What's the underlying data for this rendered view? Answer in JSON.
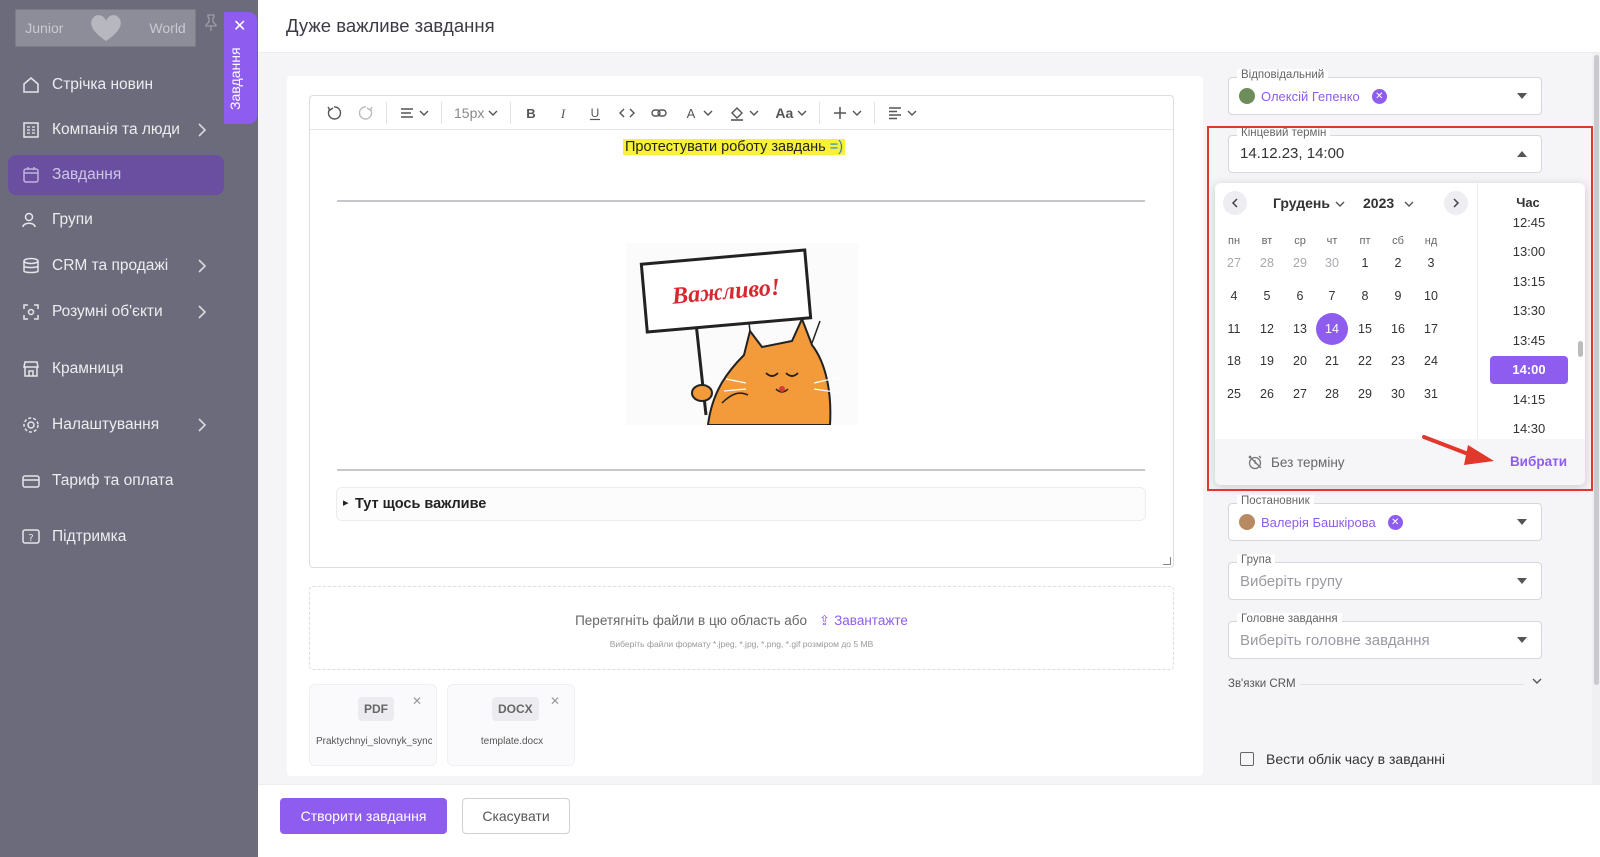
{
  "sidebar": {
    "logo_left": "Junior",
    "logo_right": "World",
    "items": [
      {
        "label": "Стрічка новин",
        "icon": "home-icon",
        "chevron": false
      },
      {
        "label": "Компанія та люди",
        "icon": "building-icon",
        "chevron": true
      },
      {
        "label": "Завдання",
        "icon": "calendar-icon",
        "chevron": false,
        "active": true
      },
      {
        "label": "Групи",
        "icon": "users-icon",
        "chevron": false
      },
      {
        "label": "CRM та продажі",
        "icon": "database-icon",
        "chevron": true
      },
      {
        "label": "Розумні об'єкти",
        "icon": "scan-icon",
        "chevron": true
      },
      {
        "label": "Крамниця",
        "icon": "store-icon",
        "chevron": false
      },
      {
        "label": "Налаштування",
        "icon": "gear-icon",
        "chevron": true
      },
      {
        "label": "Тариф та оплата",
        "icon": "card-icon",
        "chevron": false
      },
      {
        "label": "Підтримка",
        "icon": "help-icon",
        "chevron": false
      }
    ]
  },
  "vertical_tab": {
    "label": "Завдання"
  },
  "header": {
    "title": "Дуже важливе завдання"
  },
  "toolbar": {
    "font_size": "15px",
    "case_label": "Aa"
  },
  "editor": {
    "highlight_text": "Протестувати роботу завдань",
    "highlight_smile": "=)",
    "image_sign_text": "Важливо!",
    "details_summary": "Тут щось важливе"
  },
  "dropzone": {
    "main_text": "Перетягніть файли в цю область або",
    "upload_label": "Завантажте",
    "hint": "Виберіть файли формату *.jpeg, *.jpg, *.png, *.gif розміром до 5 MB"
  },
  "files": [
    {
      "type": "PDF",
      "name": "Praktychnyi_slovnyk_sync"
    },
    {
      "type": "DOCX",
      "name": "template.docx"
    }
  ],
  "footer": {
    "create_label": "Створити завдання",
    "cancel_label": "Скасувати"
  },
  "fields": {
    "responsible": {
      "label": "Відповідальний",
      "value": "Олексій Гепенко"
    },
    "deadline": {
      "label": "Кінцевий термін",
      "value": "14.12.23, 14:00"
    },
    "author": {
      "label": "Постановник",
      "value": "Валерія Башкірова"
    },
    "group": {
      "label": "Група",
      "placeholder": "Виберіть групу"
    },
    "parent": {
      "label": "Головне завдання",
      "placeholder": "Виберіть головне завдання"
    },
    "crm": {
      "label": "Зв'язки CRM"
    },
    "time_tracking": {
      "label": "Вести облік часу в завданні"
    }
  },
  "picker": {
    "month": "Грудень",
    "year": "2023",
    "weekdays": [
      "пн",
      "вт",
      "ср",
      "чт",
      "пт",
      "сб",
      "нд"
    ],
    "weeks": [
      [
        "27",
        "28",
        "29",
        "30",
        "1",
        "2",
        "3"
      ],
      [
        "4",
        "5",
        "6",
        "7",
        "8",
        "9",
        "10"
      ],
      [
        "11",
        "12",
        "13",
        "14",
        "15",
        "16",
        "17"
      ],
      [
        "18",
        "19",
        "20",
        "21",
        "22",
        "23",
        "24"
      ],
      [
        "25",
        "26",
        "27",
        "28",
        "29",
        "30",
        "31"
      ]
    ],
    "selected_day": "14",
    "time_header": "Час",
    "times": [
      "12:45",
      "13:00",
      "13:15",
      "13:30",
      "13:45",
      "14:00",
      "14:15",
      "14:30"
    ],
    "selected_time": "14:00",
    "no_deadline_label": "Без терміну",
    "choose_label": "Вибрати"
  },
  "colors": {
    "accent": "#8f5cf0",
    "annotation": "#e2382b",
    "highlight": "#f7f238"
  }
}
